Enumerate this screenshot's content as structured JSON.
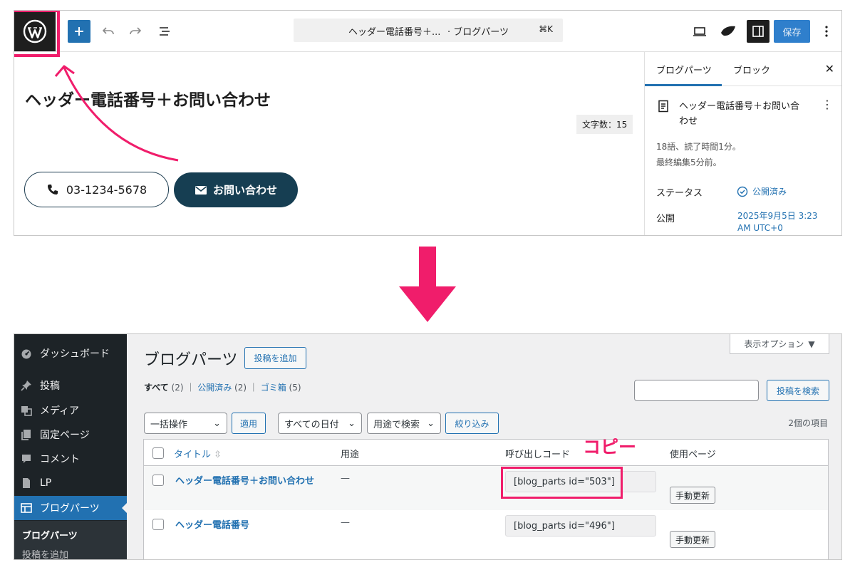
{
  "editor": {
    "command_bar": {
      "title": "ヘッダー電話番号＋...",
      "separator_text": "· ブログパーツ",
      "shortcut": "⌘K"
    },
    "save_label": "保存",
    "post_title": "ヘッダー電話番号＋お問い合わせ",
    "word_count": "文字数：15",
    "phone_button": "03-1234-5678",
    "contact_button": "お問い合わせ",
    "sidebar": {
      "tabs": [
        "ブログパーツ",
        "ブロック"
      ],
      "doc_title": "ヘッダー電話番号＋お問い合わせ",
      "meta_words": "18語、読了時間1分。",
      "meta_edited": "最終編集5分前。",
      "status_label": "ステータス",
      "status_value": "公開済み",
      "publish_label": "公開",
      "publish_value": "2025年9月5日 3:23 AM UTC+0"
    }
  },
  "admin": {
    "menu": [
      {
        "label": "ダッシュボード",
        "icon": "dashboard-icon"
      },
      {
        "label": "投稿",
        "icon": "pin-icon"
      },
      {
        "label": "メディア",
        "icon": "media-icon"
      },
      {
        "label": "固定ページ",
        "icon": "pages-icon"
      },
      {
        "label": "コメント",
        "icon": "comment-icon"
      },
      {
        "label": "LP",
        "icon": "page-icon"
      },
      {
        "label": "ブログパーツ",
        "icon": "blocks-icon"
      }
    ],
    "submenu": {
      "heading": "ブログパーツ",
      "add_new": "投稿を追加"
    },
    "screen_options": "表示オプション",
    "page_title": "ブログパーツ",
    "add_new_button": "投稿を追加",
    "views": {
      "all": "すべて",
      "all_count": "(2)",
      "published": "公開済み",
      "published_count": "(2)",
      "trash": "ゴミ箱",
      "trash_count": "(5)"
    },
    "search_button": "投稿を検索",
    "filters": {
      "bulk_action": "一括操作",
      "apply": "適用",
      "all_dates": "すべての日付",
      "search_by_use": "用途で検索",
      "filter": "絞り込み"
    },
    "items_count": "2個の項目",
    "table": {
      "columns": [
        "タイトル",
        "用途",
        "呼び出しコード",
        "使用ページ"
      ],
      "rows": [
        {
          "title": "ヘッダー電話番号＋お問い合わせ",
          "use": "—",
          "code": "[blog_parts id=\"503\"]",
          "update": "手動更新"
        },
        {
          "title": "ヘッダー電話番号",
          "use": "—",
          "code": "[blog_parts id=\"496\"]",
          "update": "手動更新"
        }
      ]
    }
  },
  "annotation": {
    "copy_label": "コピー"
  },
  "colors": {
    "accent_pink": "#f01d6b",
    "wp_blue": "#2271b1",
    "admin_dark": "#1d2327"
  }
}
